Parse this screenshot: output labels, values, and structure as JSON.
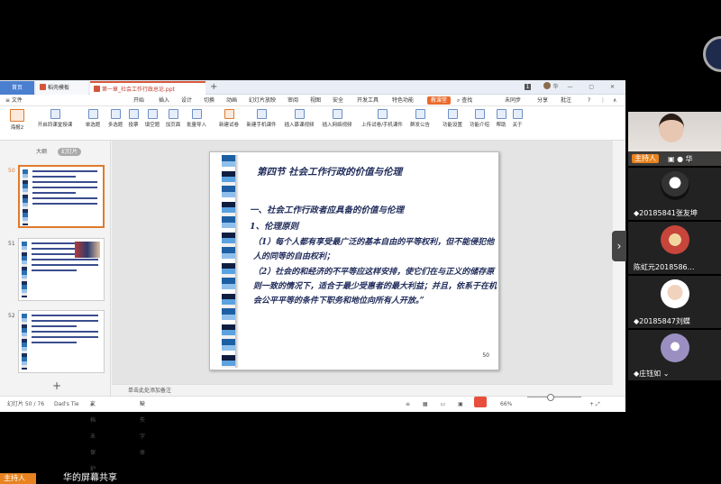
{
  "tabs": {
    "home": "首页",
    "t2": "稻壳模板",
    "t3": "第一章_社会工作行政总论.ppt",
    "plus": "+",
    "num": "1",
    "user": "华"
  },
  "menu": {
    "file": "≡ 文件",
    "items": [
      "开始",
      "插入",
      "设计",
      "切换",
      "动画",
      "幻灯片放映",
      "审阅",
      "视图",
      "安全",
      "开发工具",
      "特色功能"
    ],
    "active": "教课堂",
    "search": "查找",
    "right": [
      "未同步",
      "分享",
      "批注"
    ]
  },
  "ribbon": {
    "theme_label": "海报2",
    "items": [
      "开启同课堂授课",
      "单选题",
      "多选题",
      "投票",
      "填空题",
      "加页面",
      "批量导入",
      "新建试卷",
      "新建手机课件",
      "插入慕课视频",
      "插入网络视频",
      "上传试卷/手机课件",
      "群发公告",
      "功能设置",
      "功能介绍",
      "帮助",
      "关于"
    ]
  },
  "leftpanel": {
    "tabs": [
      "大纲",
      "幻灯片"
    ],
    "thumbs": [
      {
        "num": "50"
      },
      {
        "num": "51"
      },
      {
        "num": "52"
      }
    ],
    "add": "+"
  },
  "slide": {
    "title": "第四节  社会工作行政的价值与伦理",
    "h1": "一、社会工作行政者应具备的价值与伦理",
    "h2": "1、伦理原则",
    "p1": "（1）每个人都有享受最广泛的基本自由的平等权利，但不能侵犯他人的同等的自由权利；",
    "p2": "（2）社会的和经济的不平等应这样安排，使它们在与正义的储存原则一致的情况下，适合于最少受惠者的最大利益；并且，依系于在机会公平平等的条件下职务和地位向所有人开放。”",
    "number": "50"
  },
  "notes": "单击此处添加备注",
  "status": {
    "slide": "幻灯片 50 / 76",
    "theme": "Dad's Tie",
    "protect": "文档未保护",
    "font": "缺失字体",
    "zoom": "66%"
  },
  "participants": {
    "host_label": "主持人",
    "host_name": "华",
    "list": [
      {
        "name": "20185841张友坤"
      },
      {
        "name": "陈虹元2018586…"
      },
      {
        "name": "20185847刘蝶"
      },
      {
        "name": "庄钰如"
      }
    ]
  },
  "bottom": {
    "host": "主持人",
    "share": "华的屏幕共享"
  }
}
